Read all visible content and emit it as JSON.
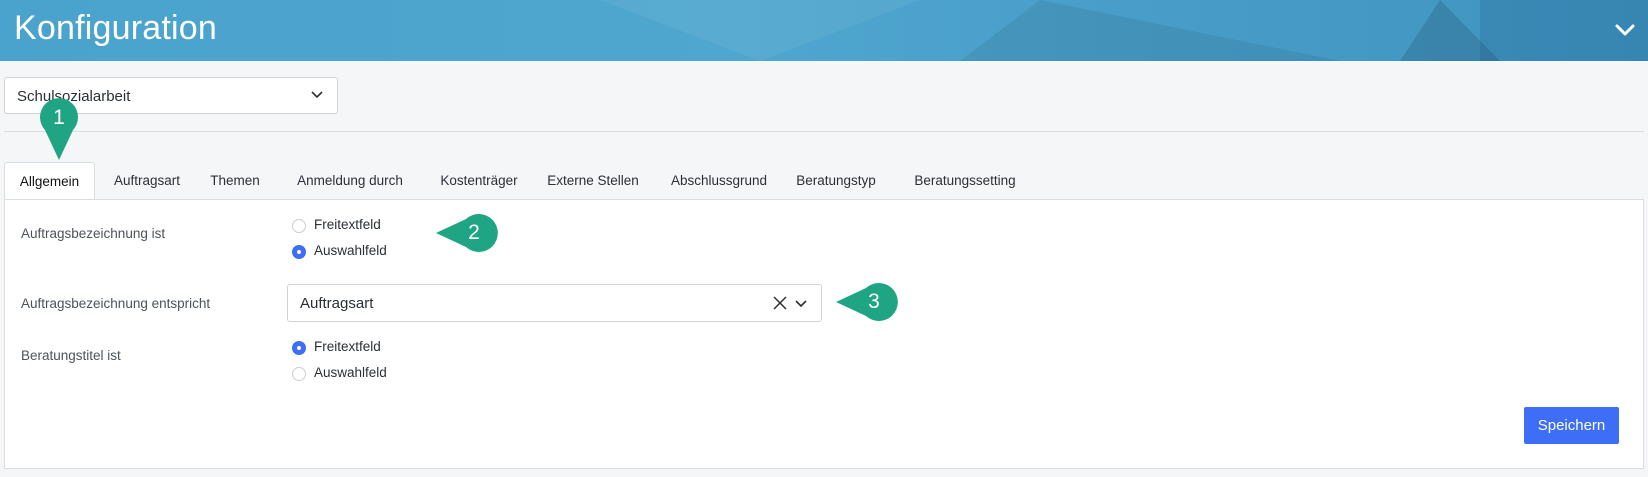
{
  "header": {
    "title": "Konfiguration"
  },
  "program_select": {
    "value": "Schulsozialarbeit"
  },
  "tabs": [
    {
      "label": "Allgemein",
      "active": true
    },
    {
      "label": "Auftragsart"
    },
    {
      "label": "Themen"
    },
    {
      "label": "Anmeldung durch"
    },
    {
      "label": "Kostenträger"
    },
    {
      "label": "Externe Stellen"
    },
    {
      "label": "Abschlussgrund"
    },
    {
      "label": "Beratungstyp"
    },
    {
      "label": "Beratungssetting"
    }
  ],
  "form": {
    "auftragsbezeichnung_ist": {
      "label": "Auftragsbezeichnung ist",
      "options": [
        "Freitextfeld",
        "Auswahlfeld"
      ],
      "selected": "Auswahlfeld"
    },
    "auftragsbezeichnung_entspricht": {
      "label": "Auftragsbezeichnung entspricht",
      "value": "Auftragsart"
    },
    "beratungstitel_ist": {
      "label": "Beratungstitel ist",
      "options": [
        "Freitextfeld",
        "Auswahlfeld"
      ],
      "selected": "Freitextfeld"
    }
  },
  "save_button": {
    "label": "Speichern"
  },
  "markers": [
    "1",
    "2",
    "3"
  ],
  "colors": {
    "accent": "#3d6ef5",
    "marker": "#1fa584",
    "header": "#4aa3cd"
  }
}
